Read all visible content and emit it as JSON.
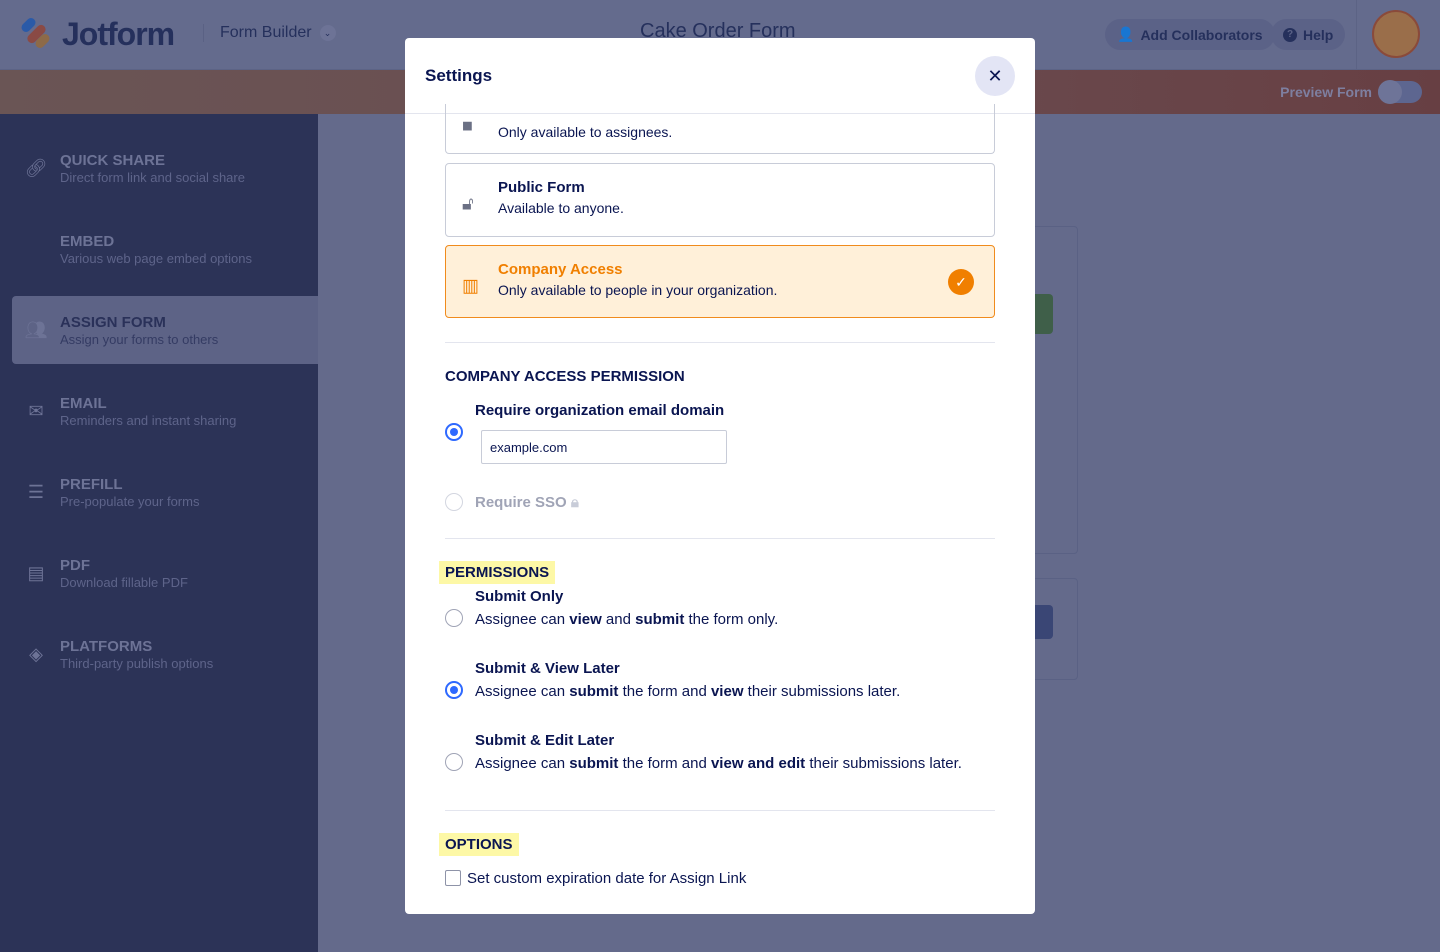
{
  "header": {
    "brand": "Jotform",
    "builder": "Form Builder",
    "form_title": "Cake Order Form",
    "add_collaborators": "Add Collaborators",
    "help": "Help",
    "preview_form": "Preview Form",
    "preview_on": false
  },
  "sidebar": {
    "items": [
      {
        "title": "QUICK SHARE",
        "sub": "Direct form link and social share",
        "icon": "link-icon"
      },
      {
        "title": "EMBED",
        "sub": "Various web page embed options",
        "icon": "code-icon"
      },
      {
        "title": "ASSIGN FORM",
        "sub": "Assign your forms to others",
        "icon": "users-icon",
        "active": true
      },
      {
        "title": "EMAIL",
        "sub": "Reminders and instant sharing",
        "icon": "envelope-icon"
      },
      {
        "title": "PREFILL",
        "sub": "Pre-populate your forms",
        "icon": "prefill-icon"
      },
      {
        "title": "PDF",
        "sub": "Download fillable PDF",
        "icon": "pdf-icon"
      },
      {
        "title": "PLATFORMS",
        "sub": "Third-party publish options",
        "icon": "layers-icon"
      }
    ]
  },
  "modal": {
    "title": "Settings",
    "access_options": [
      {
        "title": "",
        "desc": "Only available to assignees.",
        "icon": "lock-icon"
      },
      {
        "title": "Public Form",
        "desc": "Available to anyone.",
        "icon": "unlock-icon"
      },
      {
        "title": "Company Access",
        "desc": "Only available to people in your organization.",
        "icon": "building-icon",
        "selected": true
      }
    ],
    "company_permission": {
      "heading": "COMPANY ACCESS PERMISSION",
      "domain_label": "Require organization email domain",
      "domain_value": "example.com",
      "sso_label": "Require SSO",
      "selected": "domain"
    },
    "permissions": {
      "heading": "PERMISSIONS",
      "selected": 1,
      "items": [
        {
          "title": "Submit Only",
          "desc_parts": [
            "Assignee can ",
            "view",
            " and ",
            "submit",
            " the form only."
          ]
        },
        {
          "title": "Submit & View Later",
          "desc_parts": [
            "Assignee can ",
            "submit",
            " the form and ",
            "view",
            " their submissions later."
          ]
        },
        {
          "title": "Submit & Edit Later",
          "desc_parts": [
            "Assignee can ",
            "submit",
            " the form and ",
            "view and edit",
            " their submissions later."
          ]
        }
      ]
    },
    "options": {
      "heading": "OPTIONS",
      "expiration_label": "Set custom expiration date for Assign Link",
      "expiration_checked": false
    }
  },
  "colors": {
    "accent": "#f07f00",
    "radio": "#2e69ff",
    "highlight": "#fdf8a6"
  }
}
